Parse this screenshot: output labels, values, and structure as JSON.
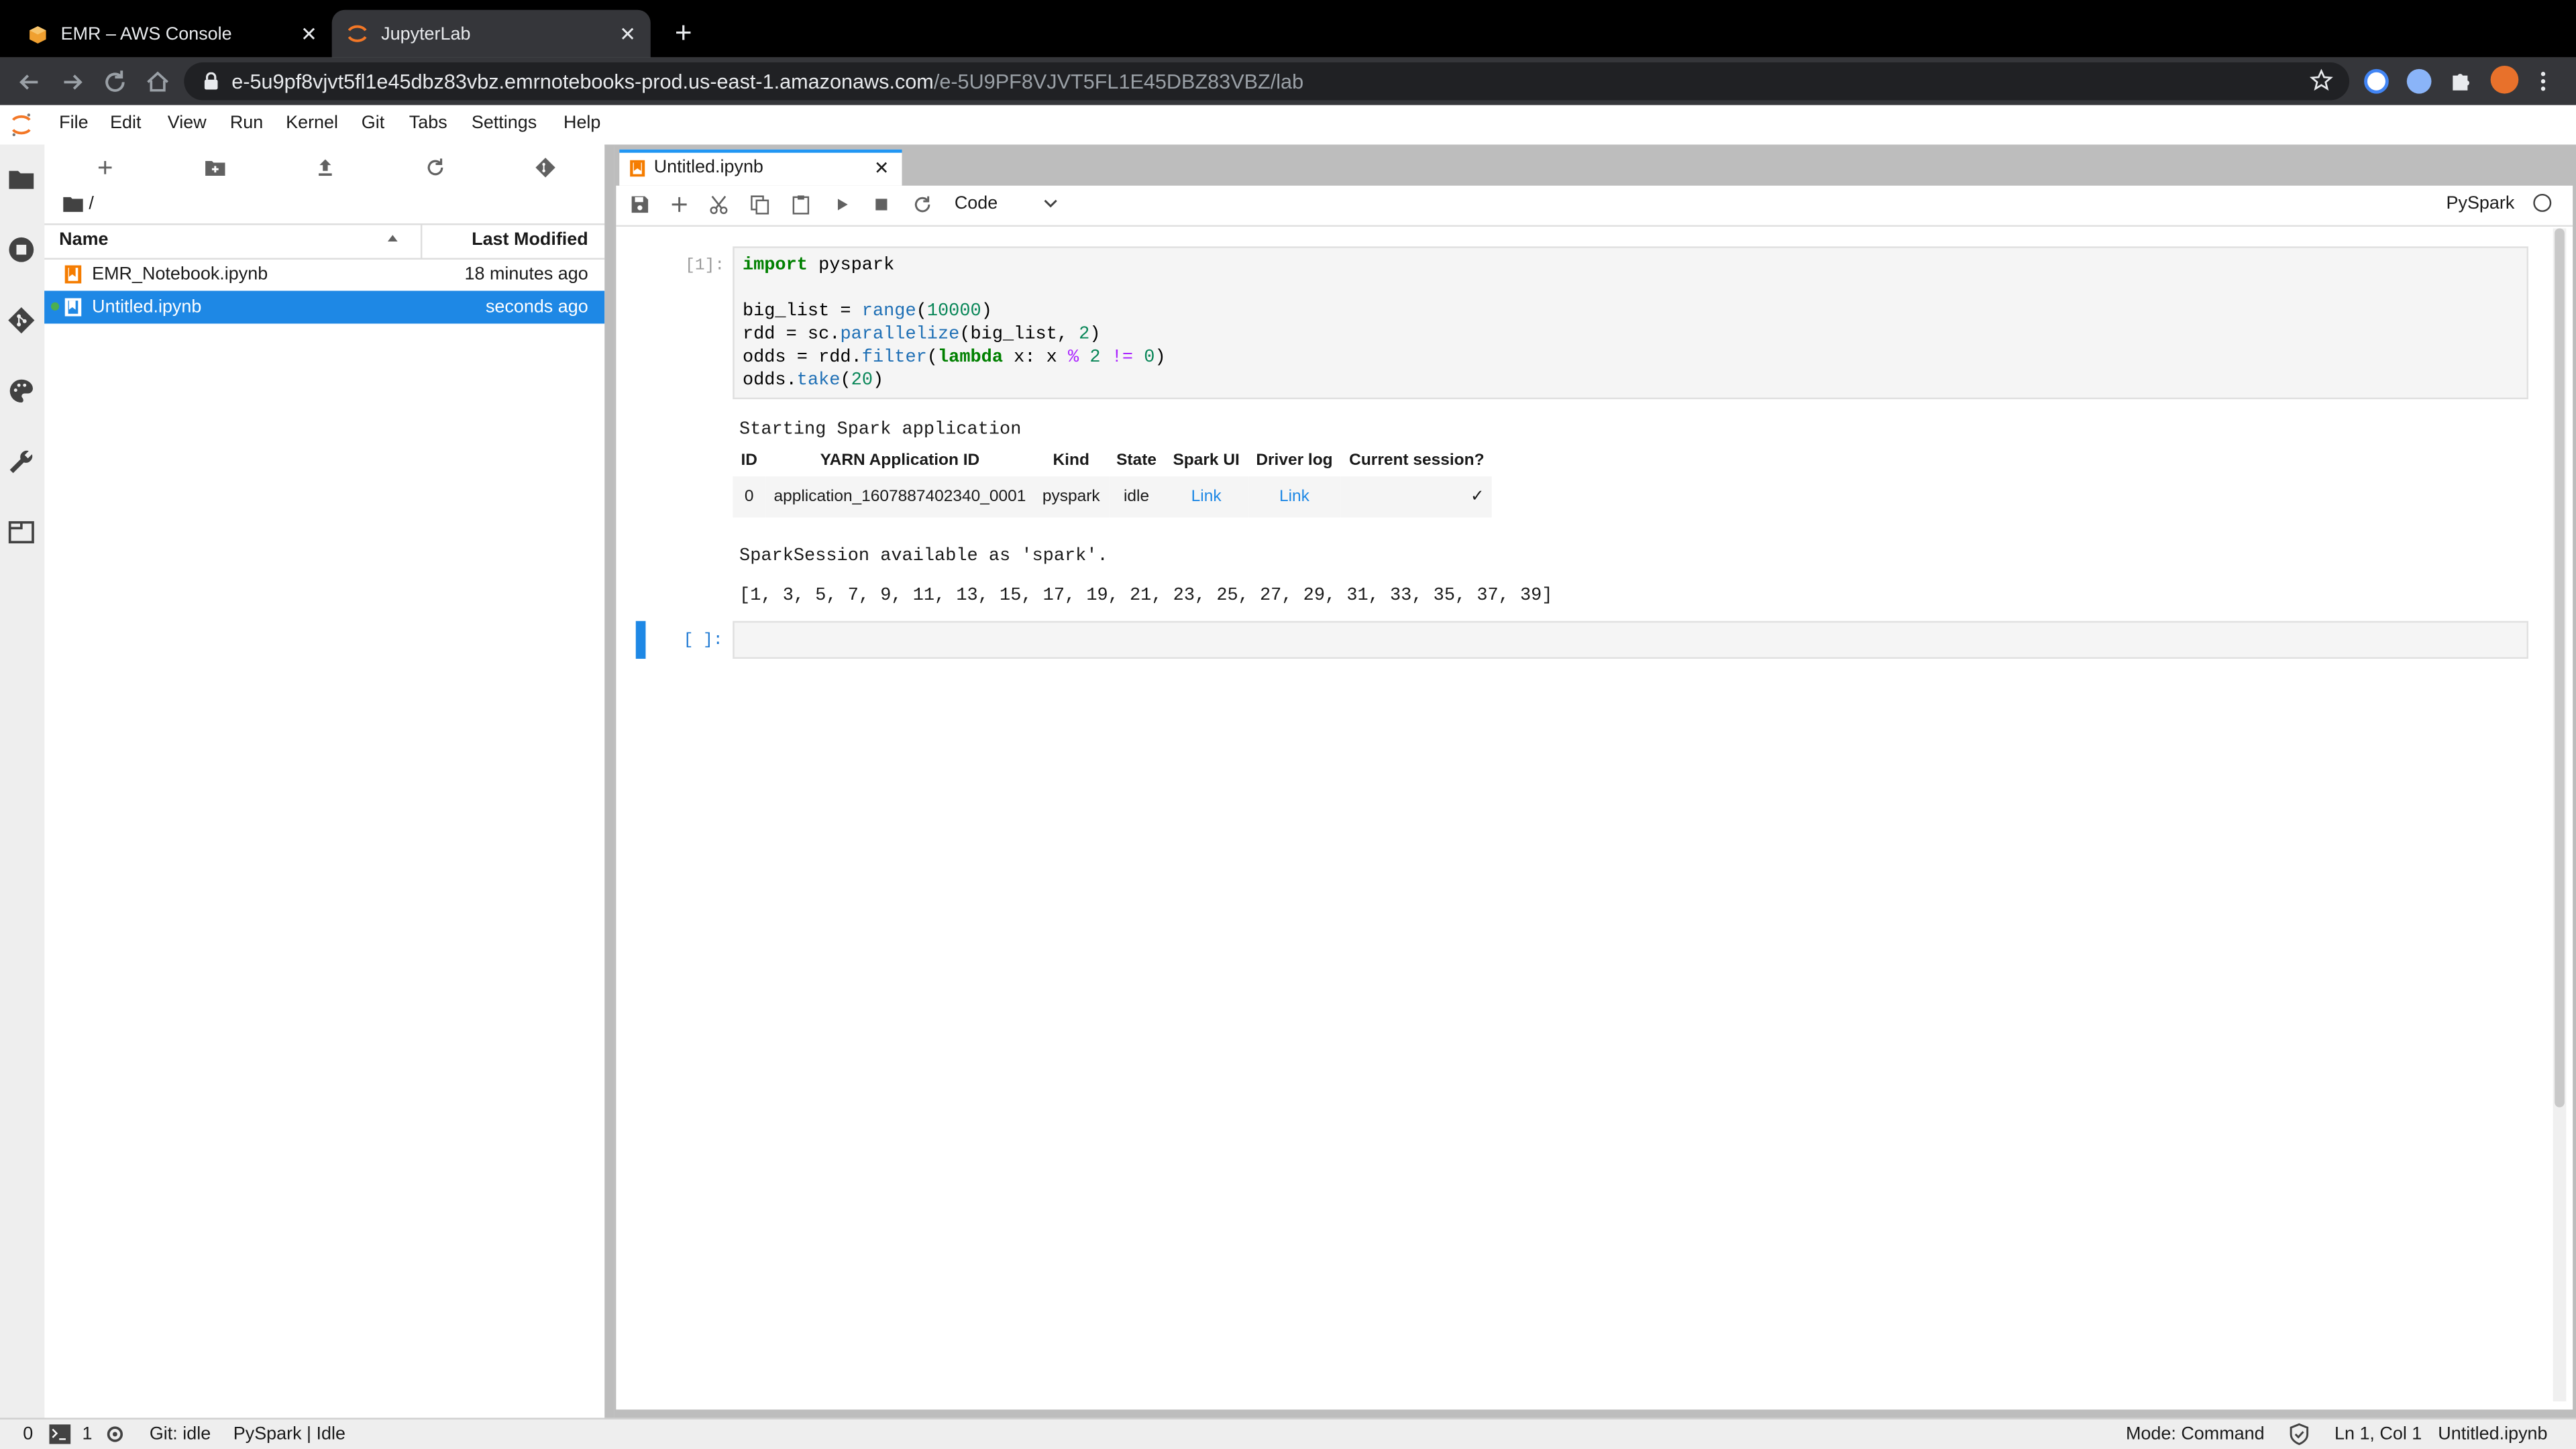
{
  "browser": {
    "tabs": [
      {
        "title": "EMR – AWS Console",
        "close": "✕"
      },
      {
        "title": "JupyterLab",
        "close": "✕"
      }
    ],
    "new_tab": "+",
    "url_host": "e-5u9pf8vjvt5fl1e45dbz83vbz.emrnotebooks-prod.us-east-1.amazonaws.com",
    "url_path": "/e-5U9PF8VJVT5FL1E45DBZ83VBZ/lab"
  },
  "menubar": {
    "items": [
      "File",
      "Edit",
      "View",
      "Run",
      "Kernel",
      "Git",
      "Tabs",
      "Settings",
      "Help"
    ]
  },
  "filebrowser": {
    "breadcrumb": "/",
    "columns": {
      "name": "Name",
      "modified": "Last Modified"
    },
    "files": [
      {
        "name": "EMR_Notebook.ipynb",
        "modified": "18 minutes ago"
      },
      {
        "name": "Untitled.ipynb",
        "modified": "seconds ago"
      }
    ]
  },
  "notebook": {
    "tab_title": "Untitled.ipynb",
    "cell_type": "Code",
    "kernel": "PySpark",
    "cell1_prompt": "[1]:",
    "cell2_prompt": "[ ]:",
    "output": {
      "starting": "Starting Spark application",
      "table_headers": [
        "ID",
        "YARN Application ID",
        "Kind",
        "State",
        "Spark UI",
        "Driver log",
        "Current session?"
      ],
      "table_row": [
        "0",
        "application_1607887402340_0001",
        "pyspark",
        "idle",
        "Link",
        "Link",
        "✓"
      ],
      "session": "SparkSession available as 'spark'.",
      "result": "[1, 3, 5, 7, 9, 11, 13, 15, 17, 19, 21, 23, 25, 27, 29, 31, 33, 35, 37, 39]"
    }
  },
  "statusbar": {
    "zero": "0",
    "one": "1",
    "git": "Git: idle",
    "kernel_status": "PySpark | Idle",
    "mode": "Mode: Command",
    "cursor": "Ln 1, Col 1",
    "file": "Untitled.ipynb"
  },
  "colors": {
    "accent": "#2196f3",
    "selection": "#1e88e5",
    "notebook_icon": "#f57c00"
  }
}
